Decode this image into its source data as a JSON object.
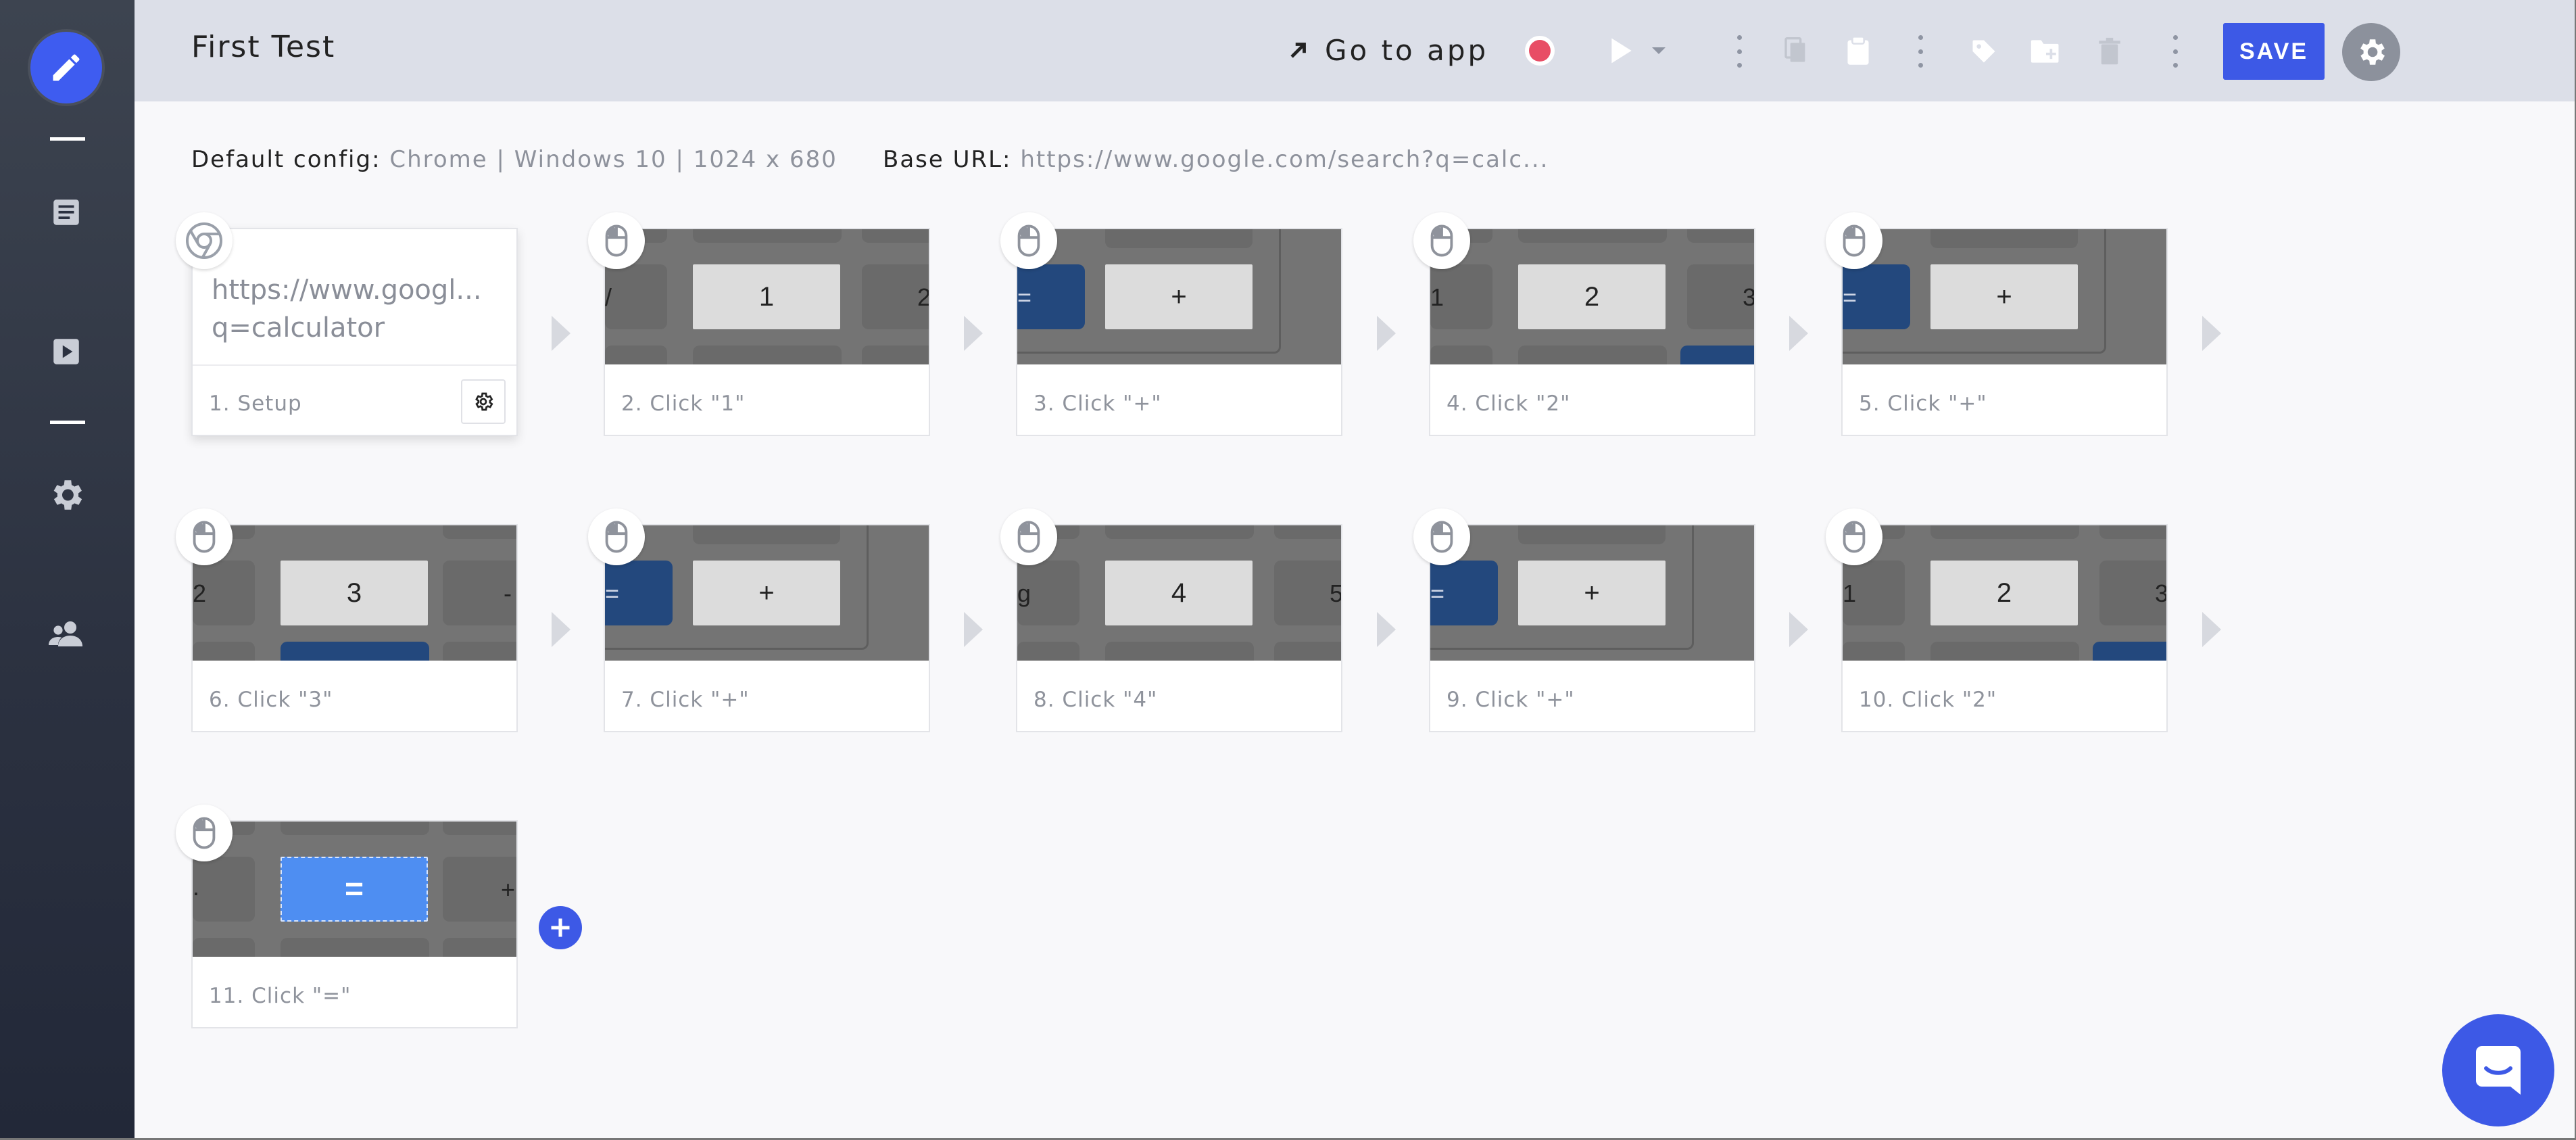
{
  "app": {
    "title": "First Test",
    "colors": {
      "accent": "#3d59e6",
      "record": "#e84d65",
      "sidebar": "#2b3140",
      "header": "#dcdfe8"
    }
  },
  "sidebar": {
    "items": [
      {
        "name": "edit-pencil-icon",
        "active": true
      },
      {
        "name": "list-icon"
      },
      {
        "name": "play-icon"
      },
      {
        "name": "gear-icon"
      },
      {
        "name": "users-icon"
      }
    ]
  },
  "toolbar": {
    "goto_label": "Go to app",
    "save_label": "SAVE",
    "icons": [
      "external-arrow-icon",
      "record-icon",
      "play-icon",
      "chevron-down-icon",
      "more-vertical-icon",
      "copy-icon",
      "clipboard-icon",
      "more-vertical-icon",
      "tag-icon",
      "folder-add-icon",
      "trash-icon",
      "more-vertical-icon",
      "code-icon",
      "chevron-down-icon",
      "settings-gear-icon"
    ]
  },
  "config": {
    "default_label": "Default config:",
    "default_value": "Chrome | Windows 10 | 1024 x 680",
    "base_url_label": "Base URL:",
    "base_url_value": "https://www.google.com/search?q=calc..."
  },
  "steps": [
    {
      "caption": "1. Setup",
      "url_line1": "https://www.googl...",
      "url_line2": "q=calculator",
      "icon": "chrome-icon"
    },
    {
      "caption": "2. Click \"1\"",
      "key": "1",
      "icon": "mouse-icon"
    },
    {
      "caption": "3. Click \"+\"",
      "key": "+",
      "icon": "mouse-icon"
    },
    {
      "caption": "4. Click \"2\"",
      "key": "2",
      "icon": "mouse-icon"
    },
    {
      "caption": "5. Click \"+\"",
      "key": "+",
      "icon": "mouse-icon"
    },
    {
      "caption": "6. Click \"3\"",
      "key": "3",
      "icon": "mouse-icon"
    },
    {
      "caption": "7. Click \"+\"",
      "key": "+",
      "icon": "mouse-icon"
    },
    {
      "caption": "8. Click \"4\"",
      "key": "4",
      "icon": "mouse-icon"
    },
    {
      "caption": "9. Click \"+\"",
      "key": "+",
      "icon": "mouse-icon"
    },
    {
      "caption": "10. Click \"2\"",
      "key": "2",
      "icon": "mouse-icon"
    },
    {
      "caption": "11. Click \"=\"",
      "key": "=",
      "icon": "mouse-icon"
    }
  ],
  "thumb_edges": {
    "s2_left": "/",
    "s2_right": "2",
    "s3_left": "=",
    "s4_left": "1",
    "s4_right": "3",
    "s5_left": "=",
    "s6_left": "2",
    "s6_right": "-",
    "s7_left": "=",
    "s8_left": "g",
    "s8_right": "5",
    "s9_left": "=",
    "s10_left": "1",
    "s10_right": "3",
    "s11_left": ".",
    "s11_right": "+"
  }
}
